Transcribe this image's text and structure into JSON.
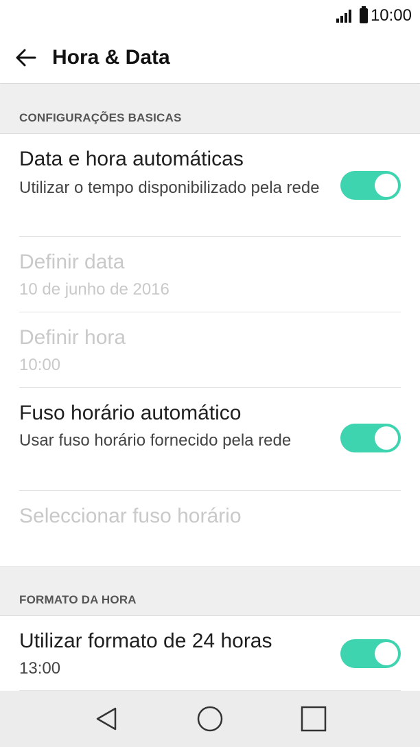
{
  "status_bar": {
    "time": "10:00"
  },
  "header": {
    "title": "Hora & Data"
  },
  "sections": {
    "basic": {
      "label": "CONFIGURAÇÕES BASICAS",
      "auto_datetime": {
        "title": "Data e hora automáticas",
        "subtitle": "Utilizar o tempo disponibilizado pela rede",
        "enabled": true
      },
      "set_date": {
        "title": "Definir data",
        "value": "10 de junho de 2016"
      },
      "set_time": {
        "title": "Definir hora",
        "value": "10:00"
      },
      "auto_timezone": {
        "title": "Fuso horário automático",
        "subtitle": "Usar fuso horário fornecido pela rede",
        "enabled": true
      },
      "select_timezone": {
        "title": "Seleccionar fuso horário"
      }
    },
    "time_format": {
      "label": "FORMATO DA HORA",
      "use_24h": {
        "title": "Utilizar formato de 24 horas",
        "value": "13:00",
        "enabled": true
      }
    }
  },
  "colors": {
    "toggle_on": "#3fd4b0",
    "disabled_text": "#c9c9c9"
  }
}
